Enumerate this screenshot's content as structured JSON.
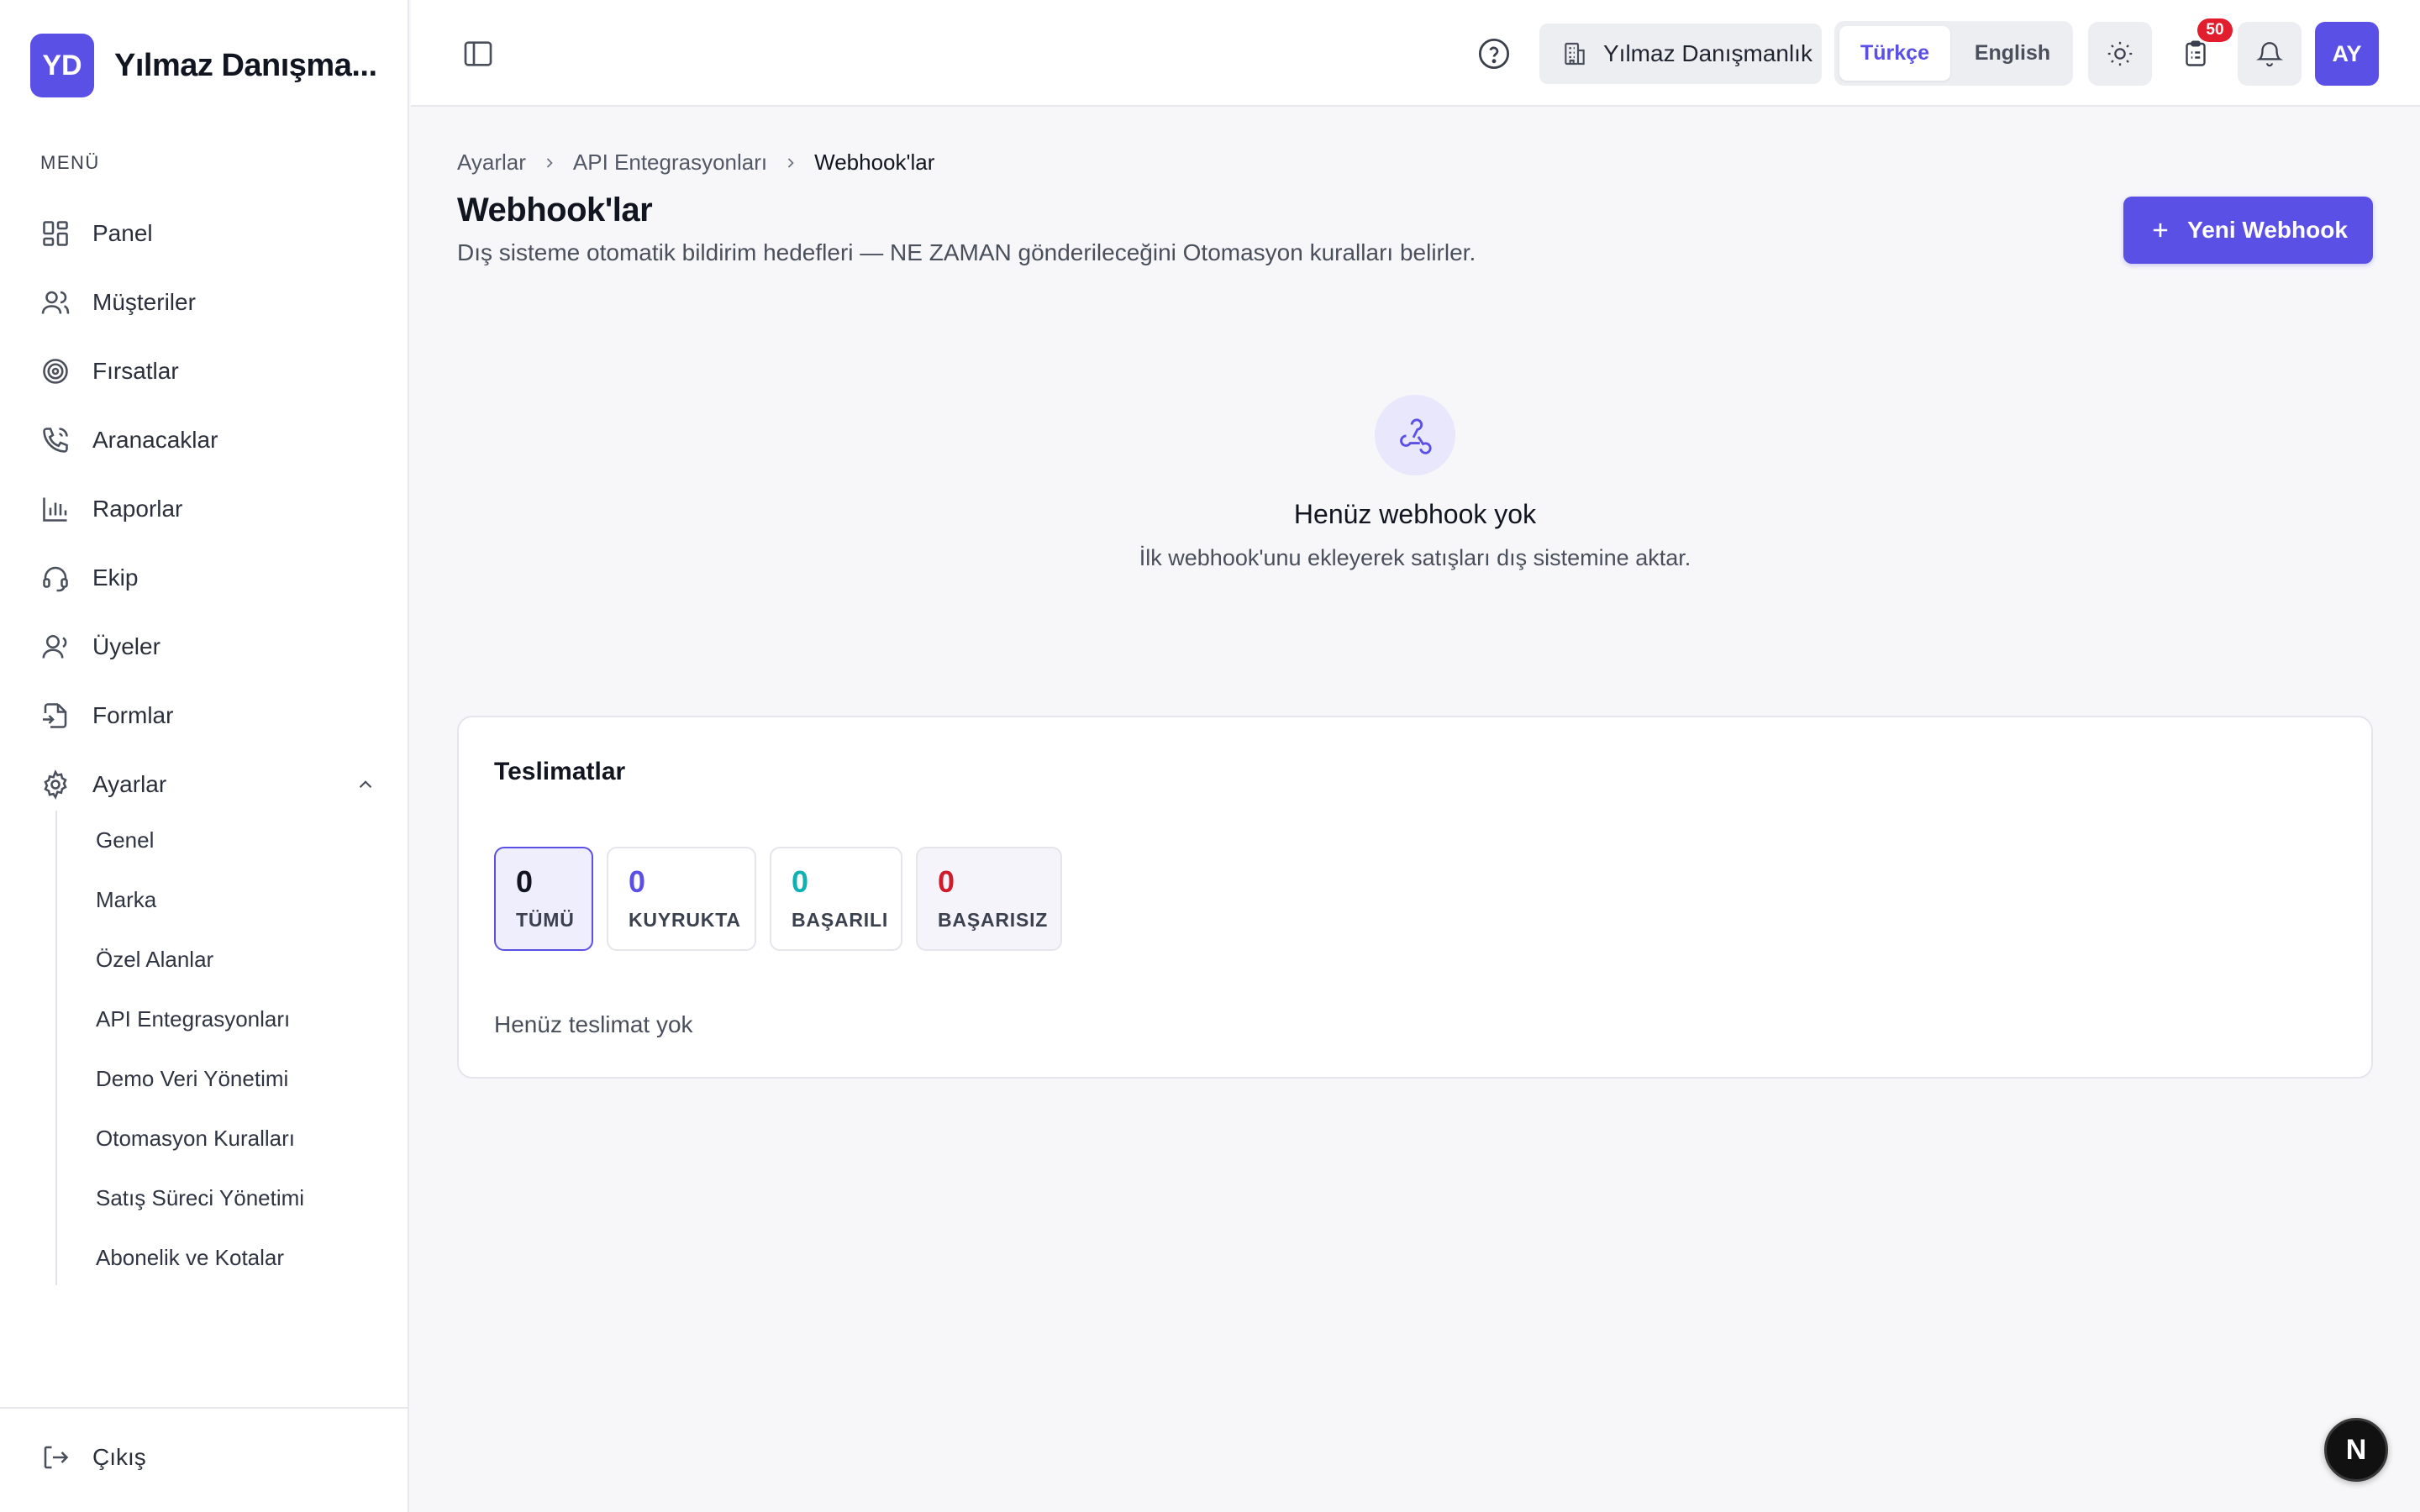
{
  "brand": {
    "initials": "YD",
    "name": "Yılmaz Danışma..."
  },
  "sidebar": {
    "menu_title": "MENÜ",
    "items": [
      {
        "label": "Panel",
        "icon": "grid-icon"
      },
      {
        "label": "Müşteriler",
        "icon": "users-icon"
      },
      {
        "label": "Fırsatlar",
        "icon": "target-icon"
      },
      {
        "label": "Aranacaklar",
        "icon": "phone-icon"
      },
      {
        "label": "Raporlar",
        "icon": "bar-chart-icon"
      },
      {
        "label": "Ekip",
        "icon": "headset-icon"
      },
      {
        "label": "Üyeler",
        "icon": "user-icon"
      },
      {
        "label": "Formlar",
        "icon": "form-icon"
      },
      {
        "label": "Ayarlar",
        "icon": "gear-icon",
        "expanded": true
      }
    ],
    "subitems": [
      "Genel",
      "Marka",
      "Özel Alanlar",
      "API Entegrasyonları",
      "Demo Veri Yönetimi",
      "Otomasyon Kuralları",
      "Satış Süreci Yönetimi",
      "Abonelik ve Kotalar"
    ],
    "logout": "Çıkış"
  },
  "topbar": {
    "org_name": "Yılmaz Danışmanlık",
    "languages": [
      "Türkçe",
      "English"
    ],
    "active_language": "Türkçe",
    "tasks_badge": "50",
    "avatar_initials": "AY"
  },
  "breadcrumb": [
    "Ayarlar",
    "API Entegrasyonları",
    "Webhook'lar"
  ],
  "page": {
    "title": "Webhook'lar",
    "subtitle": "Dış sisteme otomatik bildirim hedefleri — NE ZAMAN gönderileceğini Otomasyon kuralları belirler.",
    "new_button": "Yeni Webhook"
  },
  "empty_state": {
    "title": "Henüz webhook yok",
    "description": "İlk webhook'unu ekleyerek satışları dış sistemine aktar."
  },
  "deliveries": {
    "title": "Teslimatlar",
    "stats": [
      {
        "value": "0",
        "label": "TÜMÜ"
      },
      {
        "value": "0",
        "label": "KUYRUKTA"
      },
      {
        "value": "0",
        "label": "BAŞARILI"
      },
      {
        "value": "0",
        "label": "BAŞARISIZ"
      }
    ],
    "empty": "Henüz teslimat yok"
  },
  "fab_label": "N",
  "colors": {
    "accent": "#5b50e6",
    "success": "#10b1b1",
    "danger": "#d11a2a",
    "badge": "#e11d2e"
  }
}
